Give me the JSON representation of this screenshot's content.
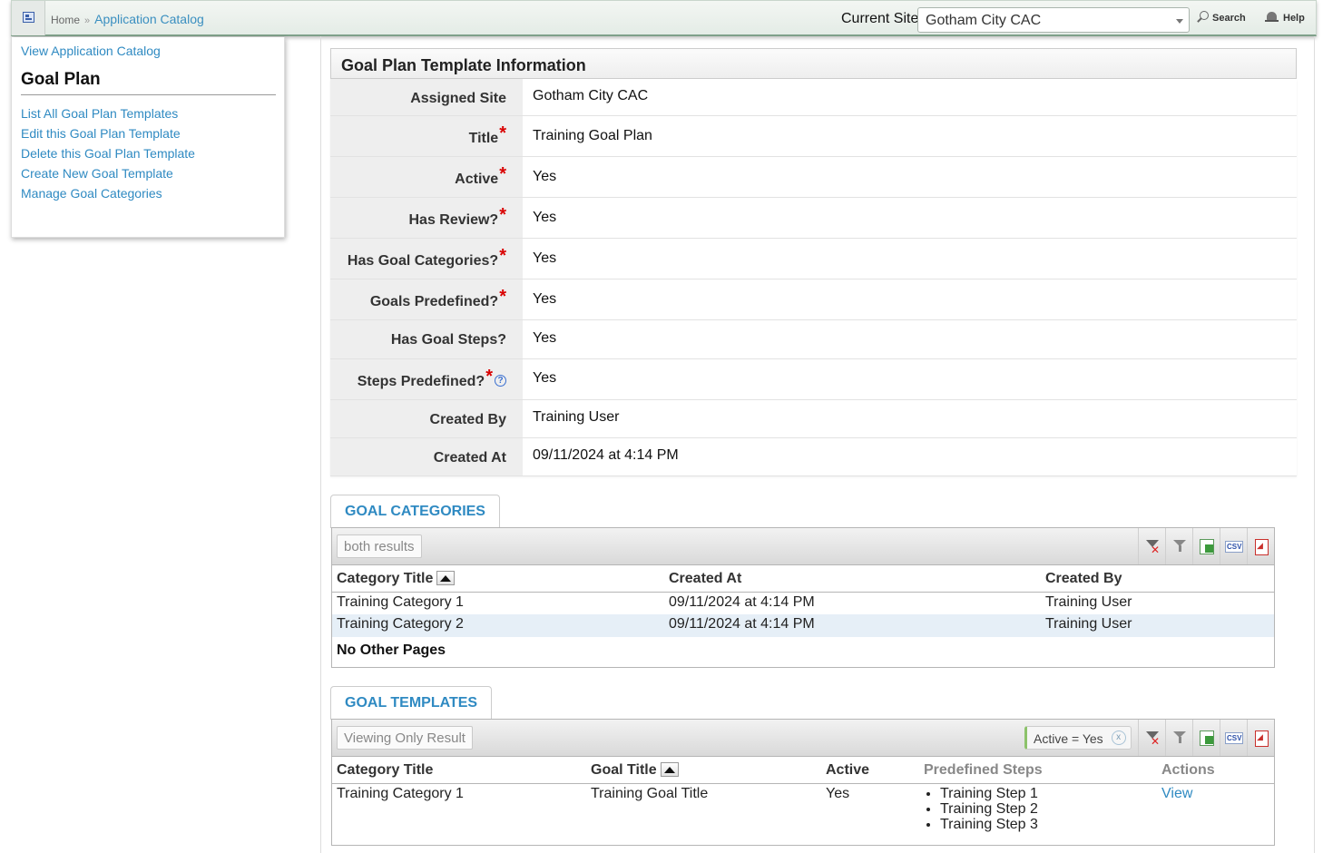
{
  "header": {
    "breadcrumb_home": "Home",
    "breadcrumb_separator": "»",
    "breadcrumb_current": "Application Catalog",
    "site_label": "Current Site",
    "site_value": "Gotham City CAC",
    "search_label": "Search",
    "help_label": "Help"
  },
  "sidebar": {
    "top_link": "View Application Catalog",
    "heading": "Goal Plan",
    "links": [
      "List All Goal Plan Templates",
      "Edit this Goal Plan Template",
      "Delete this Goal Plan Template",
      "Create New Goal Template",
      "Manage Goal Categories"
    ]
  },
  "info": {
    "title": "Goal Plan Template Information",
    "rows": [
      {
        "label": "Assigned Site",
        "value": "Gotham City CAC"
      },
      {
        "label": "Title",
        "value": "Training Goal Plan"
      },
      {
        "label": "Active",
        "value": "Yes"
      },
      {
        "label": "Has Review?",
        "value": "Yes"
      },
      {
        "label": "Has Goal Categories?",
        "value": "Yes"
      },
      {
        "label": "Goals Predefined?",
        "value": "Yes"
      },
      {
        "label": "Has Goal Steps?",
        "value": "Yes"
      },
      {
        "label": "Steps Predefined?",
        "value": "Yes"
      },
      {
        "label": "Created By",
        "value": "Training User"
      },
      {
        "label": "Created At",
        "value": "09/11/2024 at 4:14 PM"
      }
    ],
    "required_mark": "*",
    "help_mark": "?"
  },
  "categories": {
    "tab_label": "GOAL CATEGORIES",
    "result_tag": "both results",
    "columns": [
      "Category Title",
      "Created At",
      "Created By"
    ],
    "rows": [
      [
        "Training Category 1",
        "09/11/2024 at 4:14 PM",
        "Training User"
      ],
      [
        "Training Category 2",
        "09/11/2024 at 4:14 PM",
        "Training User"
      ]
    ],
    "footer": "No Other Pages"
  },
  "templates": {
    "tab_label": "GOAL TEMPLATES",
    "result_tag": "Viewing Only Result",
    "filter_chip": "Active = Yes",
    "filter_chip_close": "x",
    "columns": [
      "Category Title",
      "Goal Title",
      "Active",
      "Predefined Steps",
      "Actions"
    ],
    "rows": [
      {
        "category": "Training Category 1",
        "goal": "Training Goal Title",
        "active": "Yes",
        "steps": [
          "Training Step 1",
          "Training Step 2",
          "Training Step 3"
        ],
        "action": "View"
      }
    ]
  }
}
